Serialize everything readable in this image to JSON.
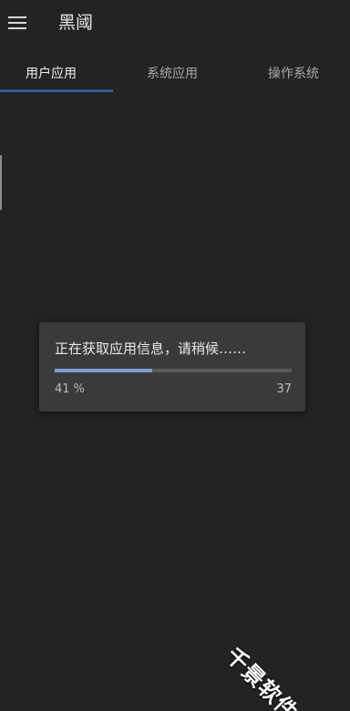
{
  "app": {
    "title": "黑阈"
  },
  "tabs": [
    {
      "label": "用户应用",
      "active": true
    },
    {
      "label": "系统应用",
      "active": false
    },
    {
      "label": "操作系统",
      "active": false
    }
  ],
  "dialog": {
    "message": "正在获取应用信息，请稍候……",
    "progress_fraction": 0.41,
    "progress_percent_text": "41 %",
    "progress_count_text": "37"
  },
  "watermark": {
    "text": "千景软件站"
  },
  "colors": {
    "background": "#232323",
    "dialog_bg": "#3a3a3a",
    "tab_indicator": "#2d5f9e",
    "progress_fill": "#7e9fd0",
    "progress_track": "#5a5a5a"
  },
  "icons": {
    "menu": "hamburger-menu-icon"
  }
}
